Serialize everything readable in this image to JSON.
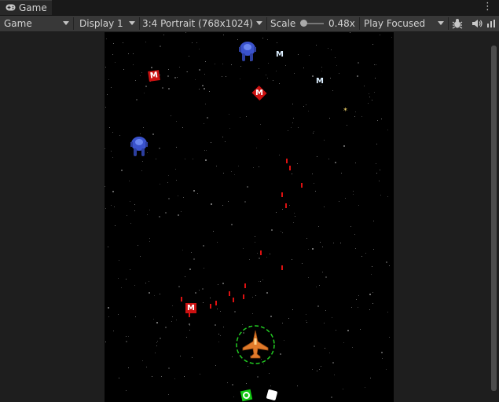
{
  "tab": {
    "label": "Game",
    "icon": "gamepad-icon"
  },
  "toolbar": {
    "view_label": "Game",
    "display_label": "Display 1",
    "aspect_label": "3:4 Portrait (768x1024)",
    "scale_label": "Scale",
    "scale_value": "0.48x",
    "play_mode_label": "Play Focused",
    "icons": [
      "bug-icon",
      "audio-icon",
      "stats-icon"
    ]
  },
  "game": {
    "pickup_letter": "M",
    "colors": {
      "background": "#000000",
      "missile_pickup": "#cc1111",
      "bullet": "#dd1111",
      "shield_ring": "#22cc22",
      "player_ship": "#e07a2a",
      "enemy": "#3a52cc"
    }
  }
}
